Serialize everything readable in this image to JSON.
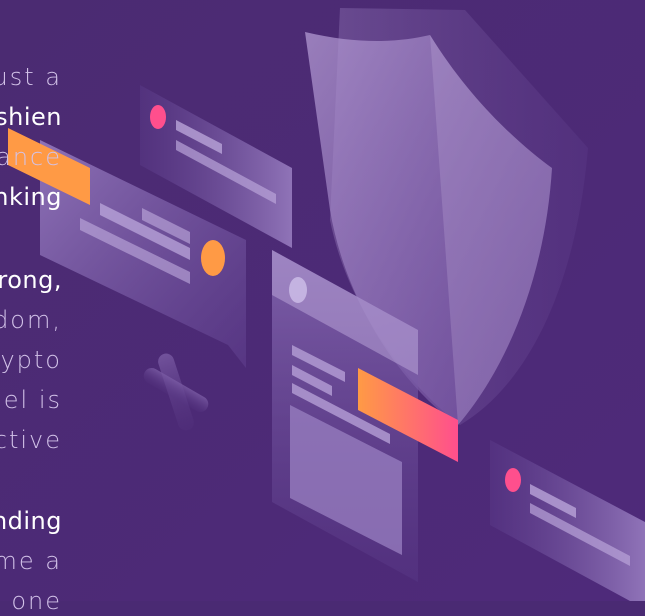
{
  "text_lines": [
    {
      "text": "ust a",
      "weight": "light"
    },
    {
      "text": "shien",
      "weight": "bold"
    },
    {
      "text": "ance",
      "weight": "light"
    },
    {
      "text": "nking",
      "weight": "bold"
    },
    {
      "text": "rong,",
      "weight": "bold"
    },
    {
      "text": "dom,",
      "weight": "light"
    },
    {
      "text": "rypto",
      "weight": "light"
    },
    {
      "text": "del is",
      "weight": "light"
    },
    {
      "text": "ctive",
      "weight": "light"
    },
    {
      "text": "nding",
      "weight": "bold"
    },
    {
      "text": "me a",
      "weight": "light"
    },
    {
      "text": "one",
      "weight": "light"
    }
  ],
  "colors": {
    "background": "#4a2a73",
    "accent_orange": "#ff9a45",
    "accent_pink": "#ff4f8d",
    "panel": "#8d6fb8"
  },
  "illustration": {
    "icons": [
      "shield-icon",
      "plus-icon",
      "card-icon",
      "phone-icon"
    ]
  }
}
